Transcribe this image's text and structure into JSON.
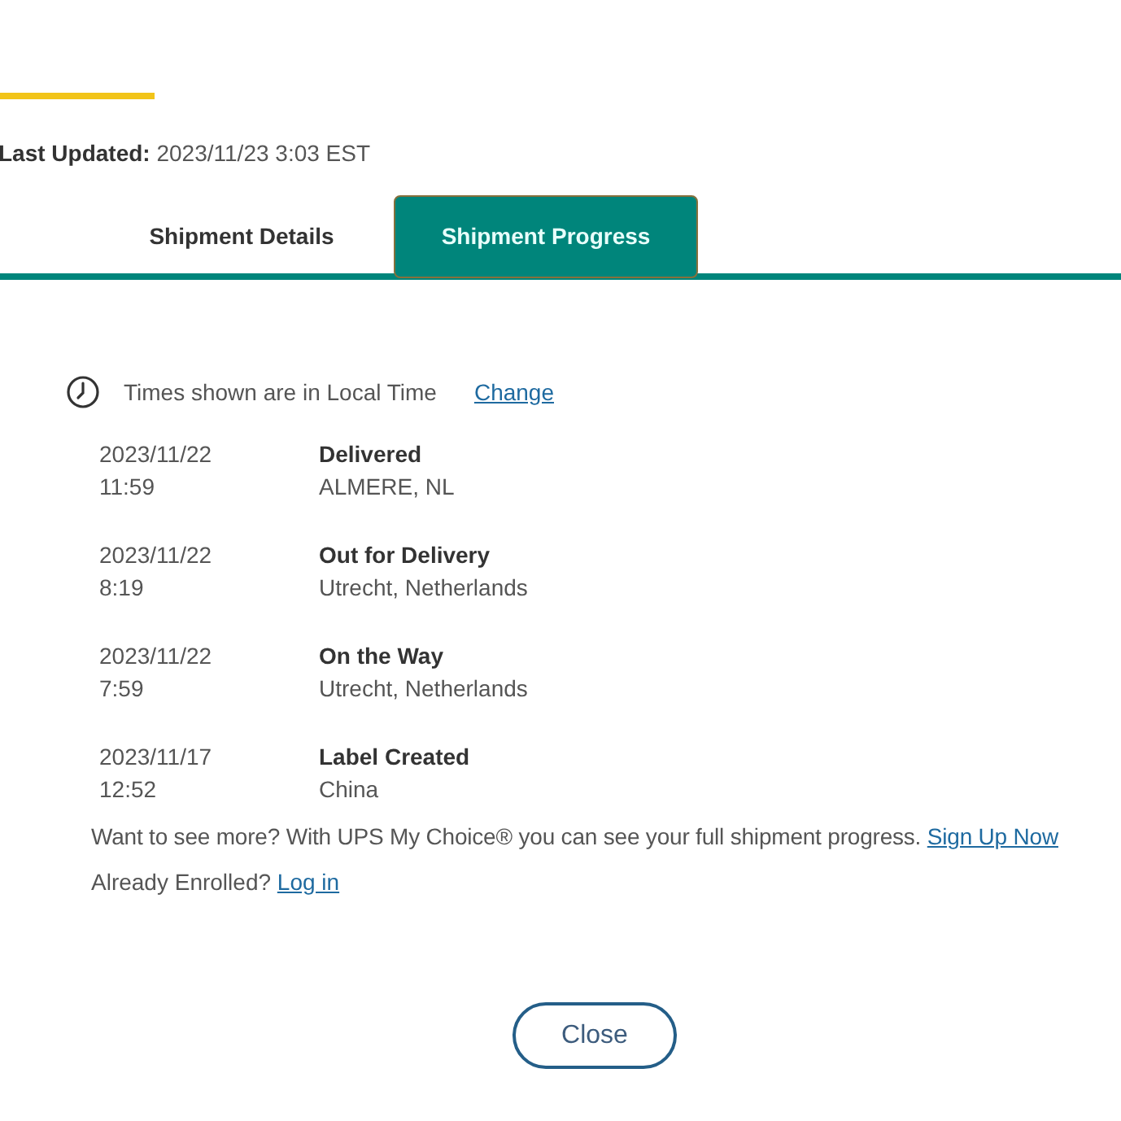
{
  "last_updated": "**Last Updated:** 2023/11/23 3:03 EST",
  "tabs": [
    {
      "label": "Shipment Details",
      "selected": false
    },
    {
      "label": "Shipment Progress",
      "selected": true
    }
  ],
  "timezone": {
    "text": "Times shown are in Local Time",
    "link": "Change"
  },
  "events": [
    {
      "date": "2023/11/22",
      "time": "11:59",
      "status": "Delivered",
      "location": "ALMERE, NL"
    },
    {
      "date": "2023/11/22",
      "time": "8:19",
      "status": "Out for Delivery",
      "location": "Utrecht, Netherlands"
    },
    {
      "date": "2023/11/22",
      "time": "7:59",
      "status": "On the Way",
      "location": "Utrecht, Netherlands"
    },
    {
      "date": "2023/11/17",
      "time": "12:52",
      "status": "Label Created",
      "location": "China"
    }
  ],
  "promo": {
    "text": "Want to see more? With UPS My Choice® you can see your full shipment progress.",
    "link": "Sign Up Now"
  },
  "login": {
    "text": "Already Enrolled?",
    "link": "Log in"
  },
  "buttons": [
    {
      "label": "Close"
    }
  ]
}
